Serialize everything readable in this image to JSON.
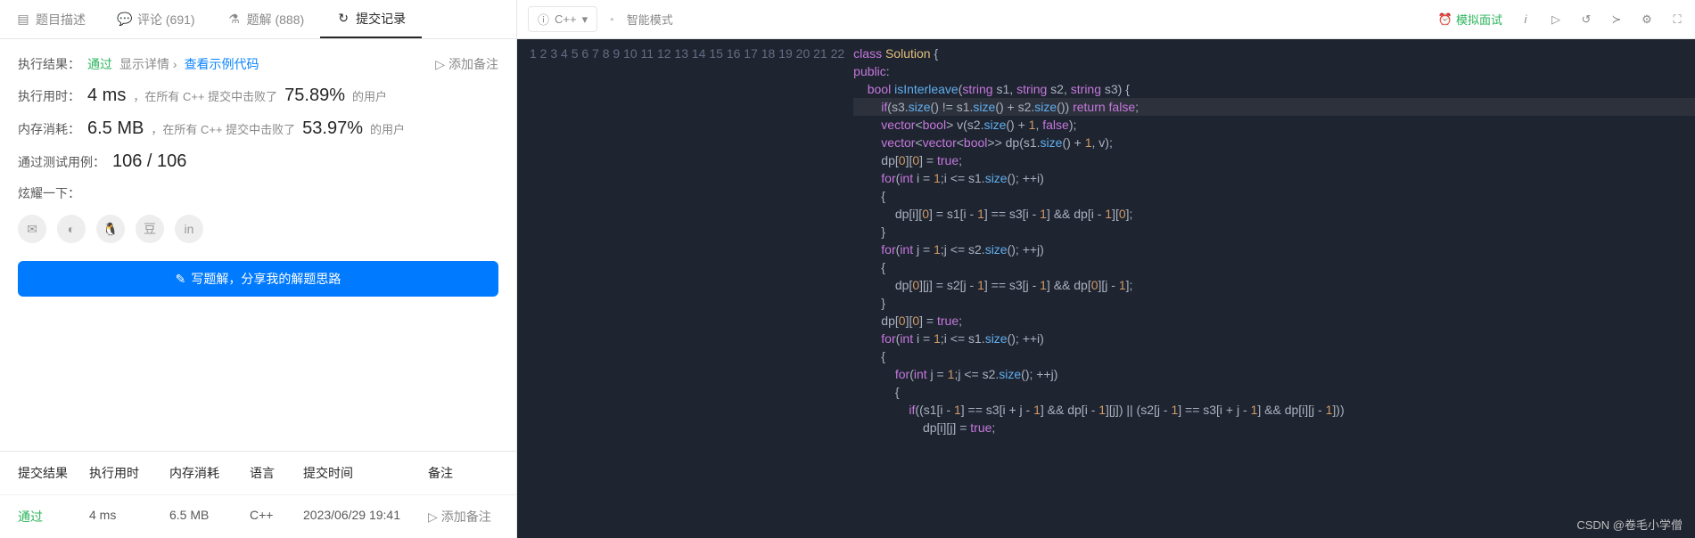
{
  "tabs": [
    {
      "icon": "doc",
      "label": "题目描述"
    },
    {
      "icon": "comment",
      "label": "评论 (691)"
    },
    {
      "icon": "flask",
      "label": "题解 (888)"
    },
    {
      "icon": "history",
      "label": "提交记录"
    }
  ],
  "result": {
    "label": "执行结果：",
    "status": "通过",
    "show_detail": "显示详情 ›",
    "example_code": "查看示例代码",
    "add_note": "添加备注",
    "time_label": "执行用时：",
    "time_val": "4 ms",
    "time_text": "，在所有 C++ 提交中击败了",
    "time_pct": "75.89%",
    "time_suffix": "的用户",
    "mem_label": "内存消耗：",
    "mem_val": "6.5 MB",
    "mem_text": "，在所有 C++ 提交中击败了",
    "mem_pct": "53.97%",
    "mem_suffix": "的用户",
    "cases_label": "通过测试用例：",
    "cases_val": "106 / 106",
    "brag_label": "炫耀一下："
  },
  "write_solution": "写题解，分享我的解题思路",
  "history": {
    "headers": [
      "提交结果",
      "执行用时",
      "内存消耗",
      "语言",
      "提交时间",
      "备注"
    ],
    "row": {
      "status": "通过",
      "time": "4 ms",
      "mem": "6.5 MB",
      "lang": "C++",
      "ts": "2023/06/29 19:41",
      "note": "添加备注"
    }
  },
  "toolbar": {
    "lang": "C++",
    "smart": "智能模式",
    "mock": "模拟面试"
  },
  "code_lines": [
    "class Solution {",
    "public:",
    "    bool isInterleave(string s1, string s2, string s3) {",
    "        if(s3.size() != s1.size() + s2.size()) return false;",
    "        vector<bool> v(s2.size() + 1, false);",
    "        vector<vector<bool>> dp(s1.size() + 1, v);",
    "        dp[0][0] = true;",
    "        for(int i = 1;i <= s1.size(); ++i)",
    "        {",
    "            dp[i][0] = s1[i - 1] == s3[i - 1] && dp[i - 1][0];",
    "        }",
    "        for(int j = 1;j <= s2.size(); ++j)",
    "        {",
    "            dp[0][j] = s2[j - 1] == s3[j - 1] && dp[0][j - 1];",
    "        }",
    "        dp[0][0] = true;",
    "        for(int i = 1;i <= s1.size(); ++i)",
    "        {",
    "            for(int j = 1;j <= s2.size(); ++j)",
    "            {",
    "                if((s1[i - 1] == s3[i + j - 1] && dp[i - 1][j]) || (s2[j - 1] == s3[i + j - 1] && dp[i][j - 1]))",
    "                    dp[i][j] = true;"
  ],
  "watermark": "CSDN @卷毛小学僧"
}
